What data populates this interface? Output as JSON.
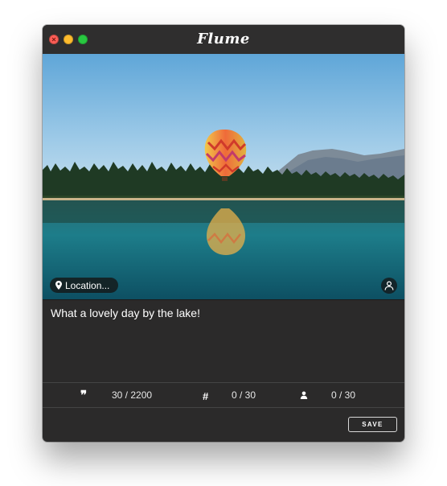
{
  "window": {
    "app_title": "Flume"
  },
  "photo": {
    "location_label": "Location..."
  },
  "composer": {
    "caption": "What a lovely day by the lake!"
  },
  "counters": {
    "characters": {
      "icon": "quote-icon",
      "value": "30 / 2200"
    },
    "hashtags": {
      "icon": "hashtag-icon",
      "value": "0 / 30"
    },
    "mentions": {
      "icon": "user-icon",
      "value": "0 / 30"
    }
  },
  "actions": {
    "save_label": "SAVE"
  },
  "colors": {
    "window_bg": "#2b2a2a",
    "traffic_close": "#fe5f57",
    "traffic_minimize": "#febc2e",
    "traffic_maximize": "#28c840"
  }
}
